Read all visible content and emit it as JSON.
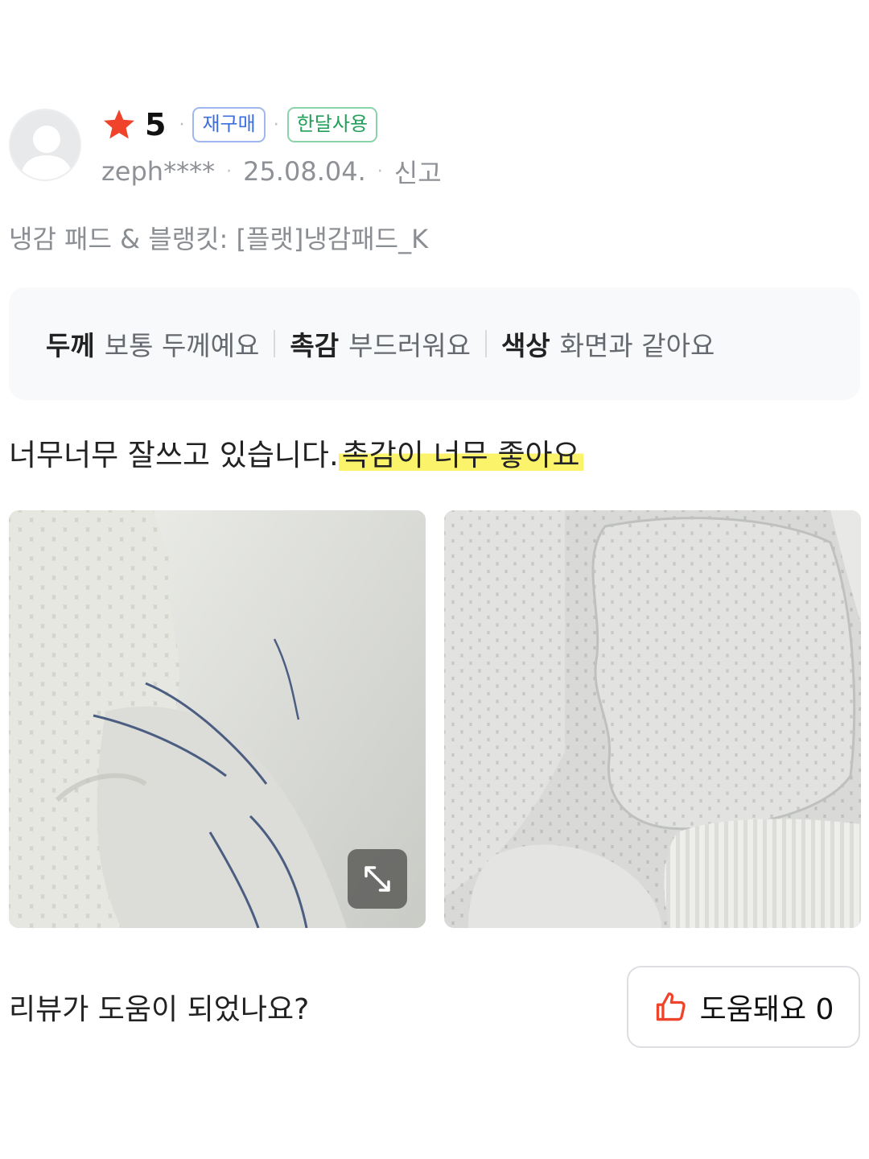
{
  "review": {
    "rating": "5",
    "badges": [
      "재구매",
      "한달사용"
    ],
    "username": "zeph****",
    "date": "25.08.04.",
    "report_label": "신고",
    "option": "냉감 패드 & 블랭킷: [플랫]냉감패드_K",
    "attributes": [
      {
        "key": "두께",
        "value": "보통 두께예요"
      },
      {
        "key": "촉감",
        "value": "부드러워요"
      },
      {
        "key": "색상",
        "value": "화면과 같아요"
      }
    ],
    "text": "너무너무 잘쓰고 있습니다.",
    "highlighted_text": "촉감이 너무 좋아요"
  },
  "footer": {
    "question": "리뷰가 도움이 되었나요?",
    "helpful_label": "도움돼요",
    "helpful_count": "0"
  },
  "icons": {
    "star": "star-icon",
    "thumbs_up": "thumbs-up-icon",
    "expand": "expand-icon",
    "avatar": "user-silhouette-icon"
  },
  "colors": {
    "star": "#f0432c",
    "badge_repurchase": "#3d6fe0",
    "badge_month_use": "#21a05a",
    "highlight": "#fbf36a",
    "thumbs_up": "#f0432c"
  }
}
